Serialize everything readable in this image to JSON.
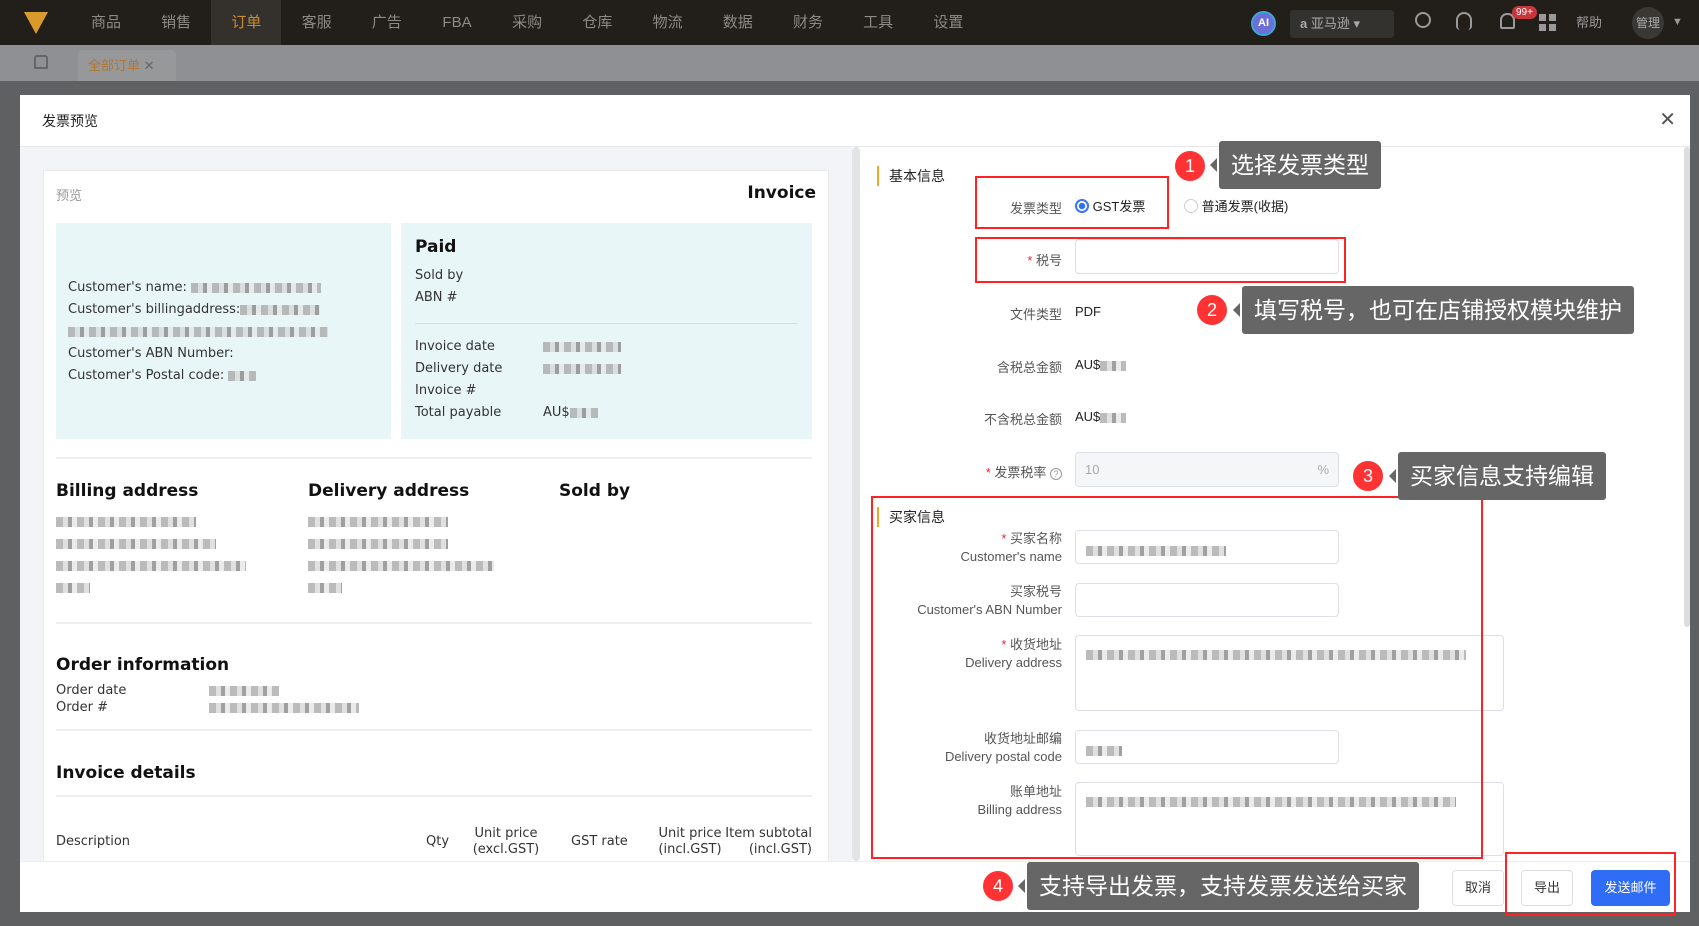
{
  "topbar": {
    "nav": [
      "商品",
      "销售",
      "订单",
      "客服",
      "广告",
      "FBA",
      "采购",
      "仓库",
      "物流",
      "数据",
      "财务",
      "工具",
      "设置"
    ],
    "active": "订单",
    "ai": "AI",
    "store": "亚马逊",
    "badge": "99+",
    "help": "帮助",
    "user": "管理"
  },
  "tabs": {
    "tab": "全部订单"
  },
  "modal": {
    "title": "发票预览"
  },
  "preview": {
    "label": "预览",
    "title": "Invoice",
    "customer": {
      "name": "Customer's name:",
      "billing": "Customer's billingaddress:",
      "abn": "Customer's ABN Number:",
      "postal": "Customer's Postal code:"
    },
    "paid": {
      "title": "Paid",
      "sold_by": "Sold by",
      "abn": "ABN #",
      "invoice_date": "Invoice date",
      "delivery_date": "Delivery date",
      "invoice_no": "Invoice #",
      "total": "Total payable",
      "total_prefix": "AU$"
    },
    "billing_address": "Billing address",
    "delivery_address": "Delivery address",
    "sold_by": "Sold by",
    "order_info": "Order information",
    "order_date": "Order date",
    "order_no": "Order #",
    "invoice_details": "Invoice details",
    "columns": [
      "Description",
      "Qty",
      "Unit price\n(excl.GST)",
      "GST rate",
      "Unit price\n(incl.GST)",
      "Item subtotal\n(incl.GST)"
    ]
  },
  "form": {
    "basic": "基本信息",
    "invoice_type_label": "发票类型",
    "type_gst": "GST发票",
    "type_normal": "普通发票(收据)",
    "tax_id_label": "税号",
    "tax_id_value": "",
    "file_type_label": "文件类型",
    "file_type": "PDF",
    "total_incl_label": "含税总金额",
    "total_incl_prefix": "AU$",
    "total_excl_label": "不含税总金额",
    "total_excl_prefix": "AU$",
    "rate_label": "发票税率",
    "rate_value": "10",
    "rate_unit": "%",
    "buyer": "买家信息",
    "buyer_name_cn": "买家名称",
    "buyer_name_en": "Customer's name",
    "buyer_abn_cn": "买家税号",
    "buyer_abn_en": "Customer's ABN Number",
    "delivery_cn": "收货地址",
    "delivery_en": "Delivery address",
    "postal_cn": "收货地址邮编",
    "postal_en": "Delivery postal code",
    "billing_cn": "账单地址",
    "billing_en": "Billing address"
  },
  "footer": {
    "cancel": "取消",
    "export": "导出",
    "send": "发送邮件"
  },
  "callouts": [
    {
      "n": "1",
      "text": "选择发票类型"
    },
    {
      "n": "2",
      "text": "填写税号，也可在店铺授权模块维护"
    },
    {
      "n": "3",
      "text": "买家信息支持编辑"
    },
    {
      "n": "4",
      "text": "支持导出发票，支持发票发送给买家"
    }
  ]
}
